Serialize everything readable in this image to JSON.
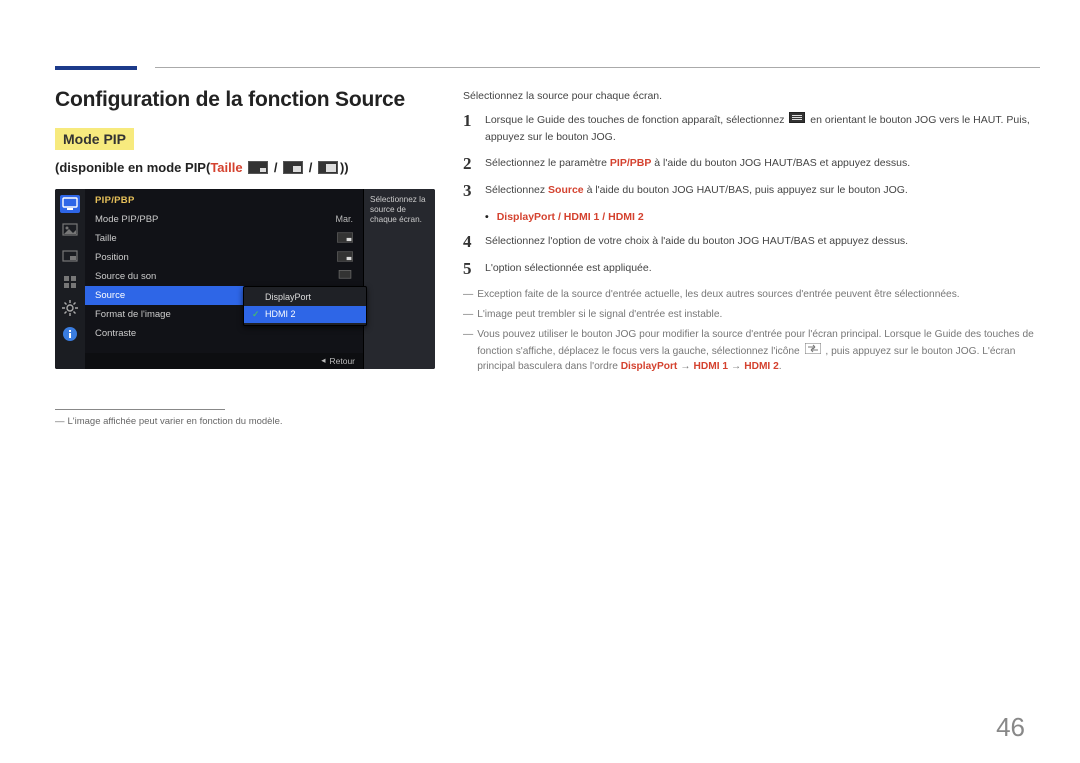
{
  "page": {
    "title": "Configuration de la fonction Source",
    "mode_box": "Mode PIP",
    "subhead_prefix": "disponible en mode PIP(",
    "subhead_taille": "Taille",
    "subhead_sep": " / ",
    "subhead_suffix": "))",
    "footnote_text": "L'image affichée peut varier en fonction du modèle.",
    "page_number": "46"
  },
  "osd": {
    "header": "PIP/PBP",
    "rows": [
      {
        "label": "Mode PIP/PBP",
        "value": "Mar."
      },
      {
        "label": "Taille",
        "value": ""
      },
      {
        "label": "Position",
        "value": ""
      },
      {
        "label": "Source du son",
        "value": ""
      },
      {
        "label": "Source",
        "value": ""
      },
      {
        "label": "Format de l'image",
        "value": ""
      },
      {
        "label": "Contraste",
        "value": ""
      }
    ],
    "help": "Sélectionnez la source de chaque écran.",
    "flyout": {
      "options": [
        {
          "label": "DisplayPort",
          "selected": false
        },
        {
          "label": "HDMI 2",
          "selected": true
        }
      ]
    },
    "footer": "Retour"
  },
  "right": {
    "intro": "Sélectionnez la source pour chaque écran.",
    "steps": {
      "s1": {
        "num": "1",
        "a": "Lorsque le Guide des touches de fonction apparaît, sélectionnez ",
        "b": " en orientant le bouton JOG vers le HAUT. Puis, appuyez sur le bouton JOG."
      },
      "s2": {
        "num": "2",
        "a": "Sélectionnez le paramètre ",
        "b": "PIP/PBP",
        "c": " à l'aide du bouton JOG HAUT/BAS et appuyez dessus."
      },
      "s3": {
        "num": "3",
        "a": "Sélectionnez ",
        "b": "Source",
        "c": " à l'aide du bouton JOG HAUT/BAS, puis appuyez sur le bouton JOG."
      },
      "bullet": "DisplayPort / HDMI 1 / HDMI 2",
      "s4": {
        "num": "4",
        "a": "Sélectionnez l'option de votre choix à l'aide du bouton JOG HAUT/BAS et appuyez dessus."
      },
      "s5": {
        "num": "5",
        "a": "L'option sélectionnée est appliquée."
      }
    },
    "notes": {
      "n1": "Exception faite de la source d'entrée actuelle, les deux autres sources d'entrée peuvent être sélectionnées.",
      "n2": "L'image peut trembler si le signal d'entrée est instable.",
      "n3a": "Vous pouvez utiliser le bouton JOG pour modifier la source d'entrée pour l'écran principal. Lorsque le Guide des touches de fonction s'affiche, déplacez le focus vers la gauche, sélectionnez l'icône ",
      "n3b": " , puis appuyez sur le bouton JOG. L'écran principal basculera dans l'ordre ",
      "n3_dp": "DisplayPort",
      "n3_h1": "HDMI 1",
      "n3_h2": "HDMI 2",
      "n3_end": "."
    }
  }
}
